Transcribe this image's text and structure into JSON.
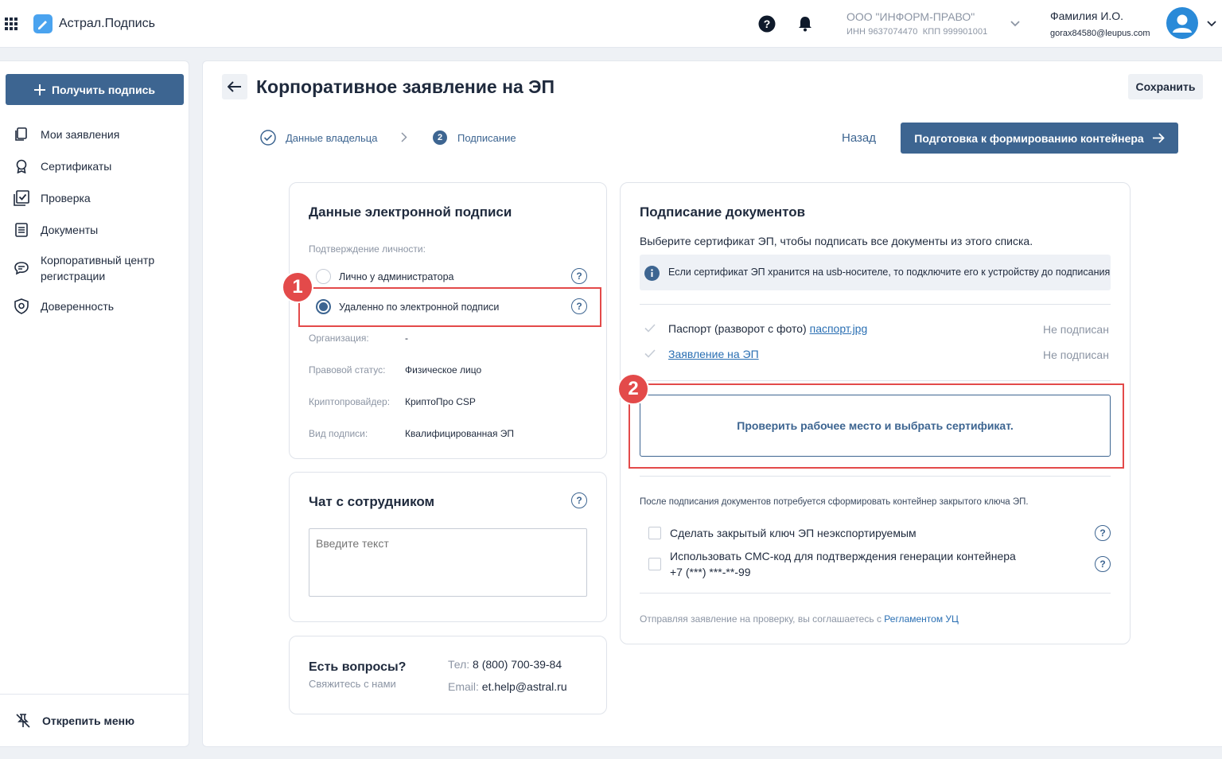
{
  "header": {
    "brand": "Астрал.Подпись",
    "org_name": "ООО \"ИНФОРМ-ПРАВО\"",
    "org_inn": "ИНН 9637074470",
    "org_kpp": "КПП 999901001",
    "user_name": "Фамилия И.О.",
    "user_email": "gorax84580@leupus.com"
  },
  "sidebar": {
    "get_sign": "Получить подпись",
    "items": [
      {
        "label": "Мои заявления",
        "icon": "documents-icon"
      },
      {
        "label": "Сертификаты",
        "icon": "award-icon"
      },
      {
        "label": "Проверка",
        "icon": "check-square-icon"
      },
      {
        "label": "Документы",
        "icon": "document-list-icon"
      },
      {
        "label": "Корпоративный центр регистрации",
        "icon": "chat-icon"
      },
      {
        "label": "Доверенность",
        "icon": "shield-icon"
      }
    ],
    "unpin": "Открепить меню"
  },
  "main": {
    "title": "Корпоративное заявление на ЭП",
    "save": "Сохранить",
    "steps": [
      {
        "label": "Данные владельца",
        "state": "done"
      },
      {
        "label": "Подписание",
        "number": "2",
        "state": "active"
      }
    ],
    "back": "Назад",
    "prepare": "Подготовка к формированию контейнера"
  },
  "signature_card": {
    "title": "Данные электронной подписи",
    "identity_label": "Подтверждение личности:",
    "options": [
      {
        "label": "Лично у администратора",
        "selected": false
      },
      {
        "label": "Удаленно по электронной подписи",
        "selected": true
      }
    ],
    "fields": [
      {
        "label": "Организация:",
        "value": "-"
      },
      {
        "label": "Правовой статус:",
        "value": "Физическое лицо"
      },
      {
        "label": "Криптопровайдер:",
        "value": "КриптоПро CSP"
      },
      {
        "label": "Вид подписи:",
        "value": "Квалифицированная ЭП"
      }
    ]
  },
  "chat_card": {
    "title": "Чат с сотрудником",
    "placeholder": "Введите текст"
  },
  "contacts_card": {
    "title": "Есть вопросы?",
    "subtitle": "Свяжитесь с нами",
    "phone_label": "Тел:",
    "phone": "8 (800) 700-39-84",
    "email_label": "Email:",
    "email": "et.help@astral.ru"
  },
  "signing_card": {
    "title": "Подписание документов",
    "description": "Выберите сертификат ЭП, чтобы подписать все документы из этого списка.",
    "info": "Если сертификат ЭП хранится на usb-носителе, то подключите его к устройству до подписания",
    "documents": [
      {
        "prefix": "Паспорт (разворот с фото)",
        "link": "паспорт.jpg",
        "status": "Не подписан"
      },
      {
        "prefix": "",
        "link": "Заявление на ЭП",
        "status": "Не подписан"
      }
    ],
    "check_button": "Проверить рабочее место и выбрать сертификат.",
    "after_note": "После подписания документов потребуется сформировать контейнер закрытого ключа ЭП.",
    "options": [
      {
        "label": "Сделать закрытый ключ ЭП неэкспортируемым",
        "sub": ""
      },
      {
        "label": "Использовать СМС-код для подтверждения генерации контейнера",
        "sub": "+7 (***) ***-**-99"
      }
    ],
    "agreement_text": "Отправляя заявление на проверку, вы соглашаетесь с",
    "agreement_link": "Регламентом УЦ"
  },
  "markers": [
    "1",
    "2"
  ],
  "colors": {
    "primary": "#3d6591",
    "accent_blue": "#2a8ad8",
    "highlight_red": "#e34a4a",
    "link": "#2a6fb3",
    "muted": "#8c95a4"
  }
}
